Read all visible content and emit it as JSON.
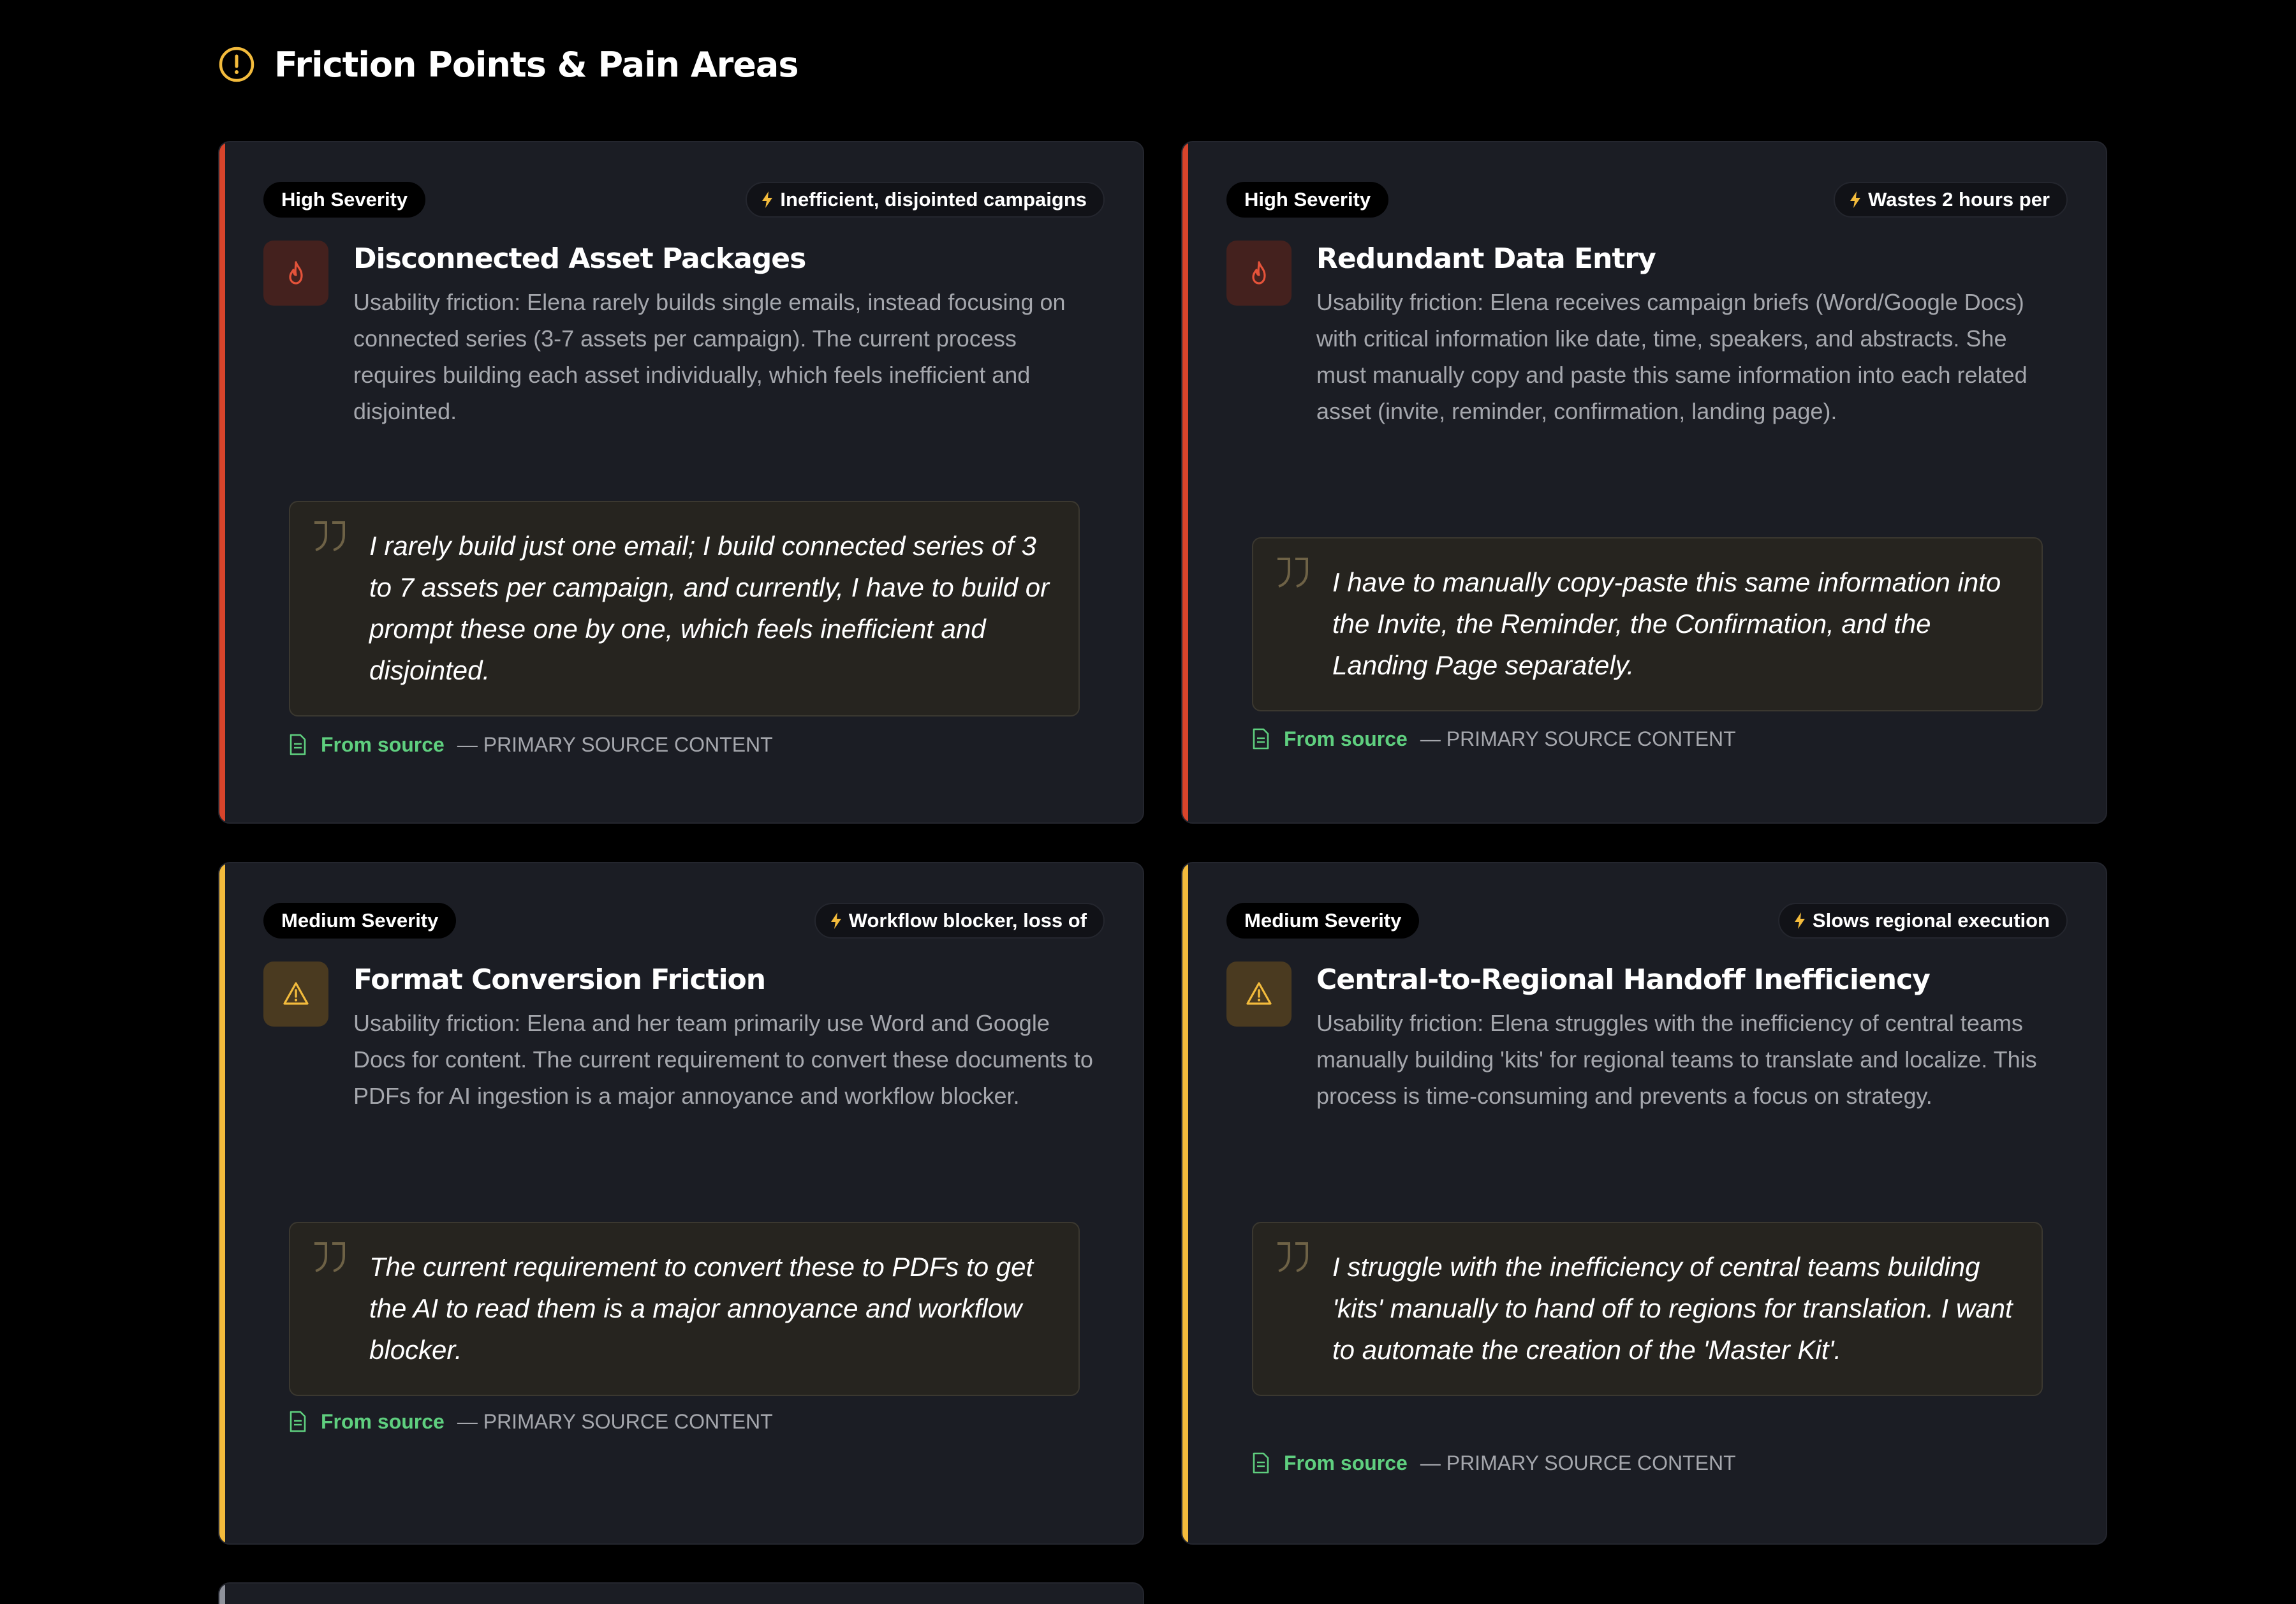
{
  "section": {
    "title": "Friction Points & Pain Areas",
    "icon": "alert-circle-icon",
    "icon_color": "#f3bb3c"
  },
  "colors": {
    "high": "#d8442b",
    "medium": "#f3bb3c",
    "source_green": "#5fcf7f",
    "card_bg": "#1b1d24",
    "page_bg": "#000000"
  },
  "cards": [
    {
      "severity": "High Severity",
      "impact": "Inefficient, disjointed campaigns",
      "icon": "flame-icon",
      "title": "Disconnected Asset Packages",
      "description": "Usability friction: Elena rarely builds single emails, instead focusing on connected series (3-7 assets per campaign). The current process requires building each asset individually, which feels inefficient and disjointed.",
      "quote": "I rarely build just one email; I build connected series of 3 to 7 assets per campaign, and currently, I have to build or prompt these one by one, which feels inefficient and disjointed.",
      "source_label": "From source",
      "source_detail": "— PRIMARY SOURCE CONTENT"
    },
    {
      "severity": "High Severity",
      "impact": "Wastes 2 hours per",
      "icon": "flame-icon",
      "title": "Redundant Data Entry",
      "description": "Usability friction: Elena receives campaign briefs (Word/Google Docs) with critical information like date, time, speakers, and abstracts. She must manually copy and paste this same information into each related asset (invite, reminder, confirmation, landing page).",
      "quote": "I have to manually copy-paste this same information into the Invite, the Reminder, the Confirmation, and the Landing Page separately.",
      "source_label": "From source",
      "source_detail": "— PRIMARY SOURCE CONTENT"
    },
    {
      "severity": "Medium Severity",
      "impact": "Workflow blocker, loss of",
      "icon": "warning-triangle-icon",
      "title": "Format Conversion Friction",
      "description": "Usability friction: Elena and her team primarily use Word and Google Docs for content. The current requirement to convert these documents to PDFs for AI ingestion is a major annoyance and workflow blocker.",
      "quote": "The current requirement to convert these to PDFs to get the AI to read them is a major annoyance and workflow blocker.",
      "source_label": "From source",
      "source_detail": "— PRIMARY SOURCE CONTENT"
    },
    {
      "severity": "Medium Severity",
      "impact": "Slows regional execution",
      "icon": "warning-triangle-icon",
      "title": "Central-to-Regional Handoff Inefficiency",
      "description": "Usability friction: Elena struggles with the inefficiency of central teams manually building 'kits' for regional teams to translate and localize. This process is time-consuming and prevents a focus on strategy.",
      "quote": "I struggle with the inefficiency of central teams building 'kits' manually to hand off to regions for translation. I want to automate the creation of the 'Master Kit'.",
      "source_label": "From source",
      "source_detail": "— PRIMARY SOURCE CONTENT"
    }
  ]
}
